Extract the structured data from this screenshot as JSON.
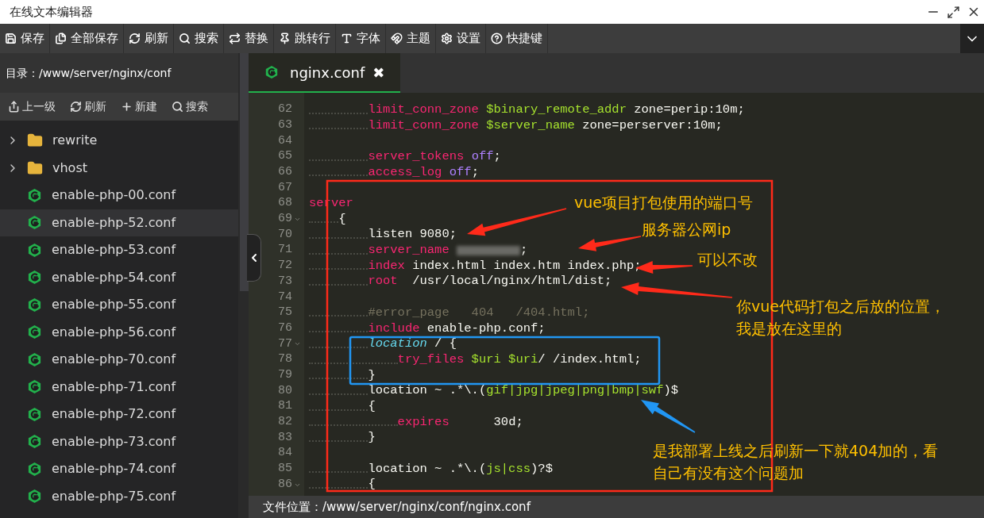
{
  "window": {
    "title": "在线文本编辑器"
  },
  "toolbar": [
    {
      "kind": "save",
      "label": "保存"
    },
    {
      "kind": "save-all",
      "label": "全部保存"
    },
    {
      "kind": "refresh",
      "label": "刷新"
    },
    {
      "kind": "search",
      "label": "搜索"
    },
    {
      "kind": "replace",
      "label": "替换"
    },
    {
      "kind": "goto",
      "label": "跳转行"
    },
    {
      "kind": "font",
      "label": "字体"
    },
    {
      "kind": "theme",
      "label": "主题"
    },
    {
      "kind": "settings",
      "label": "设置"
    },
    {
      "kind": "help",
      "label": "快捷键"
    }
  ],
  "sidebar": {
    "directory": "目录：/www/server/nginx/conf",
    "actions": [
      {
        "kind": "up",
        "label": "上一级"
      },
      {
        "kind": "refresh",
        "label": "刷新"
      },
      {
        "kind": "new",
        "label": "新建"
      },
      {
        "kind": "search",
        "label": "搜索"
      }
    ],
    "items": [
      {
        "kind": "folder",
        "name": "rewrite",
        "selected": false
      },
      {
        "kind": "folder",
        "name": "vhost",
        "selected": false
      },
      {
        "kind": "file",
        "name": "enable-php-00.conf",
        "selected": false
      },
      {
        "kind": "file",
        "name": "enable-php-52.conf",
        "selected": true
      },
      {
        "kind": "file",
        "name": "enable-php-53.conf",
        "selected": false
      },
      {
        "kind": "file",
        "name": "enable-php-54.conf",
        "selected": false
      },
      {
        "kind": "file",
        "name": "enable-php-55.conf",
        "selected": false
      },
      {
        "kind": "file",
        "name": "enable-php-56.conf",
        "selected": false
      },
      {
        "kind": "file",
        "name": "enable-php-70.conf",
        "selected": false
      },
      {
        "kind": "file",
        "name": "enable-php-71.conf",
        "selected": false
      },
      {
        "kind": "file",
        "name": "enable-php-72.conf",
        "selected": false
      },
      {
        "kind": "file",
        "name": "enable-php-73.conf",
        "selected": false
      },
      {
        "kind": "file",
        "name": "enable-php-74.conf",
        "selected": false
      },
      {
        "kind": "file",
        "name": "enable-php-75.conf",
        "selected": false
      }
    ]
  },
  "tab": {
    "label": "nginx.conf",
    "close": "✖"
  },
  "code": [
    {
      "number": "62",
      "fold": false,
      "kind": "body",
      "tokens": [
        {
          "kind": "keyword",
          "text": "limit_conn_zone "
        },
        {
          "kind": "variable",
          "text": "$binary_remote_addr "
        },
        {
          "kind": "plain",
          "text": "zone=perip:10m;"
        }
      ]
    },
    {
      "number": "63",
      "fold": false,
      "kind": "body",
      "tokens": [
        {
          "kind": "keyword",
          "text": "limit_conn_zone "
        },
        {
          "kind": "variable",
          "text": "$server_name "
        },
        {
          "kind": "plain",
          "text": "zone=perserver:10m;"
        }
      ]
    },
    {
      "number": "64",
      "fold": false
    },
    {
      "number": "65",
      "fold": false,
      "kind": "body",
      "tokens": [
        {
          "kind": "keyword",
          "text": "server_tokens "
        },
        {
          "kind": "constant",
          "text": "off"
        },
        {
          "kind": "plain",
          "text": ";"
        }
      ]
    },
    {
      "number": "66",
      "fold": false,
      "kind": "body",
      "tokens": [
        {
          "kind": "keyword",
          "text": "access_log "
        },
        {
          "kind": "constant",
          "text": "off"
        },
        {
          "kind": "plain",
          "text": ";"
        }
      ]
    },
    {
      "number": "67",
      "fold": false
    },
    {
      "number": "68",
      "fold": false,
      "tokens": [
        {
          "kind": "keyword",
          "text": "server"
        }
      ]
    },
    {
      "number": "69",
      "fold": true,
      "kind": "block",
      "tokens": [
        {
          "kind": "plain",
          "text": "{"
        }
      ]
    },
    {
      "number": "70",
      "fold": false,
      "kind": "body",
      "tokens": [
        {
          "kind": "plain",
          "text": "listen 9080;"
        }
      ]
    },
    {
      "number": "71",
      "fold": false,
      "kind": "body",
      "tokens": [
        {
          "kind": "keyword",
          "text": "server_name "
        },
        {
          "kind": "redacted"
        },
        {
          "kind": "plain",
          "text": ";"
        }
      ]
    },
    {
      "number": "72",
      "fold": false,
      "kind": "body",
      "tokens": [
        {
          "kind": "keyword",
          "text": "index "
        },
        {
          "kind": "plain",
          "text": "index.html index.htm index.php;"
        }
      ]
    },
    {
      "number": "73",
      "fold": false,
      "kind": "body",
      "tokens": [
        {
          "kind": "keyword",
          "text": "root  "
        },
        {
          "kind": "plain",
          "text": "/usr/local/nginx/html/dist;"
        }
      ]
    },
    {
      "number": "74",
      "fold": false
    },
    {
      "number": "75",
      "fold": false,
      "kind": "body",
      "tokens": [
        {
          "kind": "comment",
          "text": "#error_page   404   /404.html;"
        }
      ]
    },
    {
      "number": "76",
      "fold": false,
      "kind": "body",
      "tokens": [
        {
          "kind": "keyword",
          "text": "include "
        },
        {
          "kind": "plain",
          "text": "enable-php.conf;"
        }
      ]
    },
    {
      "number": "77",
      "fold": true,
      "kind": "body",
      "tokens": [
        {
          "kind": "builtin",
          "text": "location"
        },
        {
          "kind": "plain",
          "text": " / {"
        }
      ]
    },
    {
      "number": "78",
      "fold": false,
      "kind": "inner",
      "tokens": [
        {
          "kind": "keyword",
          "text": "try_files "
        },
        {
          "kind": "variable",
          "text": "$uri $uri"
        },
        {
          "kind": "plain",
          "text": "/ /index.html;"
        }
      ]
    },
    {
      "number": "79",
      "fold": false,
      "kind": "body",
      "tokens": [
        {
          "kind": "plain",
          "text": "}"
        }
      ]
    },
    {
      "number": "80",
      "fold": false,
      "kind": "body",
      "tokens": [
        {
          "kind": "plain",
          "text": "location ~ .*\\.("
        },
        {
          "kind": "variable",
          "text": "gif|jpg|jpeg|png|bmp|swf"
        },
        {
          "kind": "plain",
          "text": ")$"
        }
      ]
    },
    {
      "number": "81",
      "fold": false,
      "kind": "body",
      "tokens": [
        {
          "kind": "plain",
          "text": "{"
        }
      ]
    },
    {
      "number": "82",
      "fold": false,
      "kind": "inner",
      "tokens": [
        {
          "kind": "keyword",
          "text": "expires"
        },
        {
          "kind": "plain",
          "text": "      30d;"
        }
      ]
    },
    {
      "number": "83",
      "fold": false,
      "kind": "body",
      "tokens": [
        {
          "kind": "plain",
          "text": "}"
        }
      ]
    },
    {
      "number": "84",
      "fold": false
    },
    {
      "number": "85",
      "fold": false,
      "kind": "body",
      "tokens": [
        {
          "kind": "plain",
          "text": "location ~ .*\\.("
        },
        {
          "kind": "variable",
          "text": "js|css"
        },
        {
          "kind": "plain",
          "text": ")?$"
        }
      ]
    },
    {
      "number": "86",
      "fold": true,
      "kind": "body",
      "tokens": [
        {
          "kind": "plain",
          "text": "{"
        }
      ]
    }
  ],
  "annotations": [
    {
      "lines": [
        "vue项目打包使用的端口号"
      ]
    },
    {
      "lines": [
        "服务器公网ip"
      ]
    },
    {
      "lines": [
        "可以不改"
      ]
    },
    {
      "lines": [
        "你vue代码打包之后放的位置，",
        "我是放在这里的"
      ]
    },
    {
      "lines": [
        "是我部署上线之后刷新一下就404加的，看",
        "自己有没有这个问题加"
      ]
    }
  ],
  "status_bar": "文件位置：/www/server/nginx/conf/nginx.conf"
}
